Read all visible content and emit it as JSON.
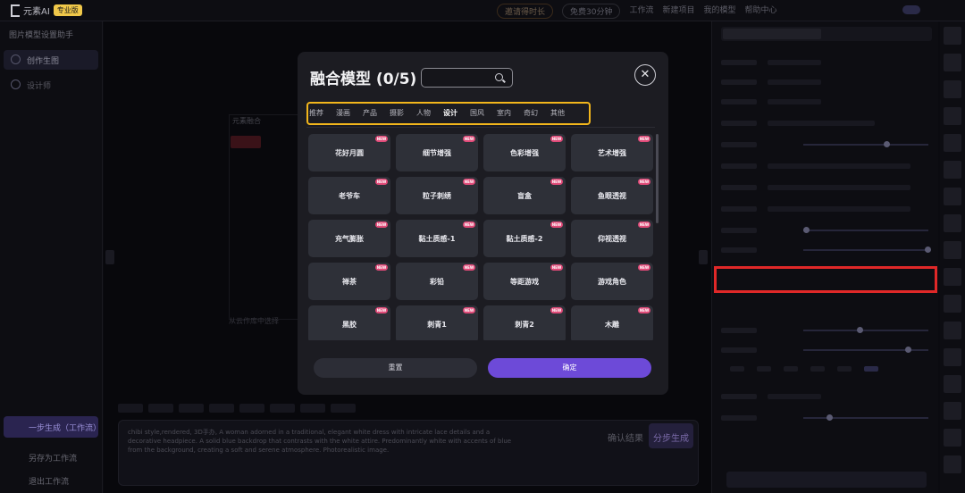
{
  "topbar": {
    "logo_text": "元素AI",
    "pro_badge": "专业版",
    "pill_1": "邀请得时长",
    "pill_2": "免费30分钟",
    "nav_items": [
      "工作流",
      "新建项目",
      "我的模型",
      "帮助中心"
    ]
  },
  "left": {
    "crumb": "图片模型设置助手",
    "nav_active": "创作生图",
    "nav_2": "设计师",
    "generate_btn": "一步生成（工作流）",
    "save": "另存为工作流",
    "exit": "退出工作流"
  },
  "center": {
    "ghost_tab": "元素融合",
    "ghost_hint": "从云作库中选择",
    "prompt_text": "chibi style,rendered, 3D手办, A woman adorned in a traditional, elegant white dress with intricate lace details and a decorative headpiece. A solid blue backdrop that contrasts with the white attire. Predominantly white with accents of blue from the background, creating a soft and serene atmosphere. Photorealistic image.",
    "confirm_result": "确认结果",
    "step_generate": "分步生成"
  },
  "modal": {
    "title": "融合模型 (0/5)",
    "search_placeholder": "",
    "close_symbol": "✕",
    "categories": [
      "推荐",
      "漫画",
      "产品",
      "摄影",
      "人物",
      "设计",
      "国风",
      "室内",
      "奇幻",
      "其他"
    ],
    "active_category": "设计",
    "new_badge": "NEW",
    "cards": [
      "花好月圆",
      "细节增强",
      "色彩增强",
      "艺术增强",
      "老爷车",
      "粒子刺绣",
      "盲盒",
      "鱼眼透视",
      "充气膨胀",
      "黏土质感-1",
      "黏土质感-2",
      "仰视透视",
      "禅茶",
      "彩铅",
      "等距游戏",
      "游戏角色",
      "黑胶",
      "刺青1",
      "刺青2",
      "木雕"
    ],
    "reset_label": "重置",
    "ok_label": "确定"
  },
  "colors": {
    "accent": "#6d4ad8",
    "highlight_box": "#f2b61c",
    "red_box": "#e02828",
    "new_badge": "#e04a78"
  }
}
